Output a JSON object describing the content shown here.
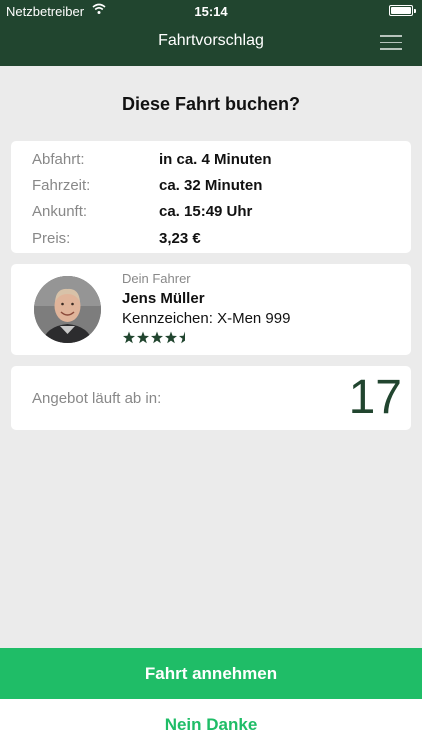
{
  "status_bar": {
    "carrier": "Netzbetreiber",
    "time": "15:14",
    "wifi_icon": "wifi-icon",
    "battery_icon": "battery-icon"
  },
  "nav": {
    "title": "Fahrtvorschlag",
    "menu_icon": "hamburger-menu-icon"
  },
  "prompt": {
    "title": "Diese Fahrt buchen?"
  },
  "trip": {
    "rows": [
      {
        "label": "Abfahrt:",
        "value": "in ca. 4 Minuten"
      },
      {
        "label": "Fahrzeit:",
        "value": "ca. 32 Minuten"
      },
      {
        "label": "Ankunft:",
        "value": "ca. 15:49 Uhr"
      },
      {
        "label": "Preis:",
        "value": "3,23 €"
      }
    ]
  },
  "driver": {
    "caption": "Dein Fahrer",
    "name": "Jens Müller",
    "plate": "Kennzeichen: X-Men 999",
    "rating_stars": 4.5,
    "rating_max": 5
  },
  "offer": {
    "label": "Angebot läuft ab in:",
    "countdown": "17"
  },
  "actions": {
    "accept_label": "Fahrt annehmen",
    "decline_label": "Nein Danke"
  },
  "colors": {
    "header_bg": "#21452f",
    "accent_green": "#1fbd67",
    "dark_green": "#21452f",
    "background": "#ebebeb"
  }
}
